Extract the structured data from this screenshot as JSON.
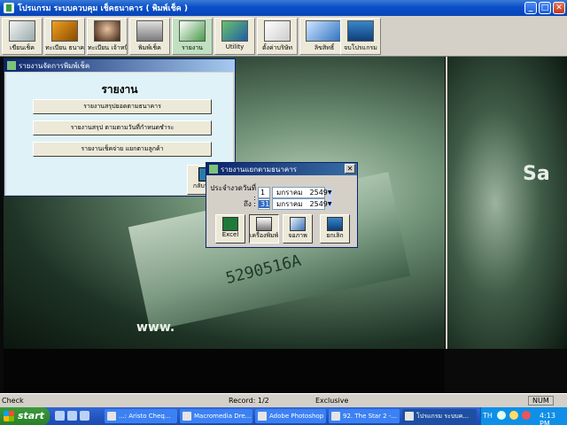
{
  "window": {
    "title": "โปรแกรม ระบบควบคุม เช็คธนาคาร ( พิมพ์เช็ค )"
  },
  "toolbar": {
    "items": [
      {
        "label": "เขียนเช็ค"
      },
      {
        "label": "ทะเบียน ธนาคาร"
      },
      {
        "label": "ทะเบียน เจ้าหนี้"
      },
      {
        "label": "พิมพ์เช็ค"
      },
      {
        "label": "รายงาน"
      },
      {
        "label": "Utility"
      },
      {
        "label": "ตั้งค่าบริษัท"
      },
      {
        "label": "ลิขสิทธิ์"
      },
      {
        "label": "จบโปรแกรม"
      }
    ]
  },
  "background": {
    "watermark": "www.",
    "serial": "5290516A",
    "right_text": "Sa"
  },
  "report_window": {
    "title": "รายงานจัดการพิมพ์เช็ค",
    "heading": "รายงาน",
    "buttons": [
      "รายงานสรุปยอดตามธนาคาร",
      "รายงานสรุป ตามตามวันที่กำหนดชำระ",
      "รายงานเช็คจ่าย แยกตามลูกค้า"
    ],
    "back_label": "กลับหน้า"
  },
  "dialog": {
    "title": "รายงานแยกตามธนาคาร",
    "from_label": "ประจำงวดวันที่ :",
    "from": {
      "day": "1",
      "month": "มกราคม",
      "year": "2549"
    },
    "to_label": "ถึง :",
    "to": {
      "day": "31",
      "month": "มกราคม",
      "year": "2549"
    },
    "buttons": [
      {
        "label": "Excel"
      },
      {
        "label": "เครื่องพิมพ์"
      },
      {
        "label": "จอภาพ"
      },
      {
        "label": "ยกเลิก"
      }
    ]
  },
  "statusbar": {
    "left": "Check",
    "record": "Record: 1/2",
    "mode": "Exclusive",
    "num": "NUM"
  },
  "taskbar": {
    "start": "start",
    "tasks": [
      "...: Aristo Cheq...",
      "Macromedia Dre...",
      "Adobe Photoshop",
      "92. The Star 2 -...",
      "โปรแกรม ระบบค..."
    ],
    "tray_lang": "TH",
    "clock": "4:13 PM"
  },
  "colors": {
    "title_bar": "#0a4fc9",
    "dialog_title": "#0a246a",
    "report_body": "#dff2f7",
    "start": "#3c9a3c"
  }
}
